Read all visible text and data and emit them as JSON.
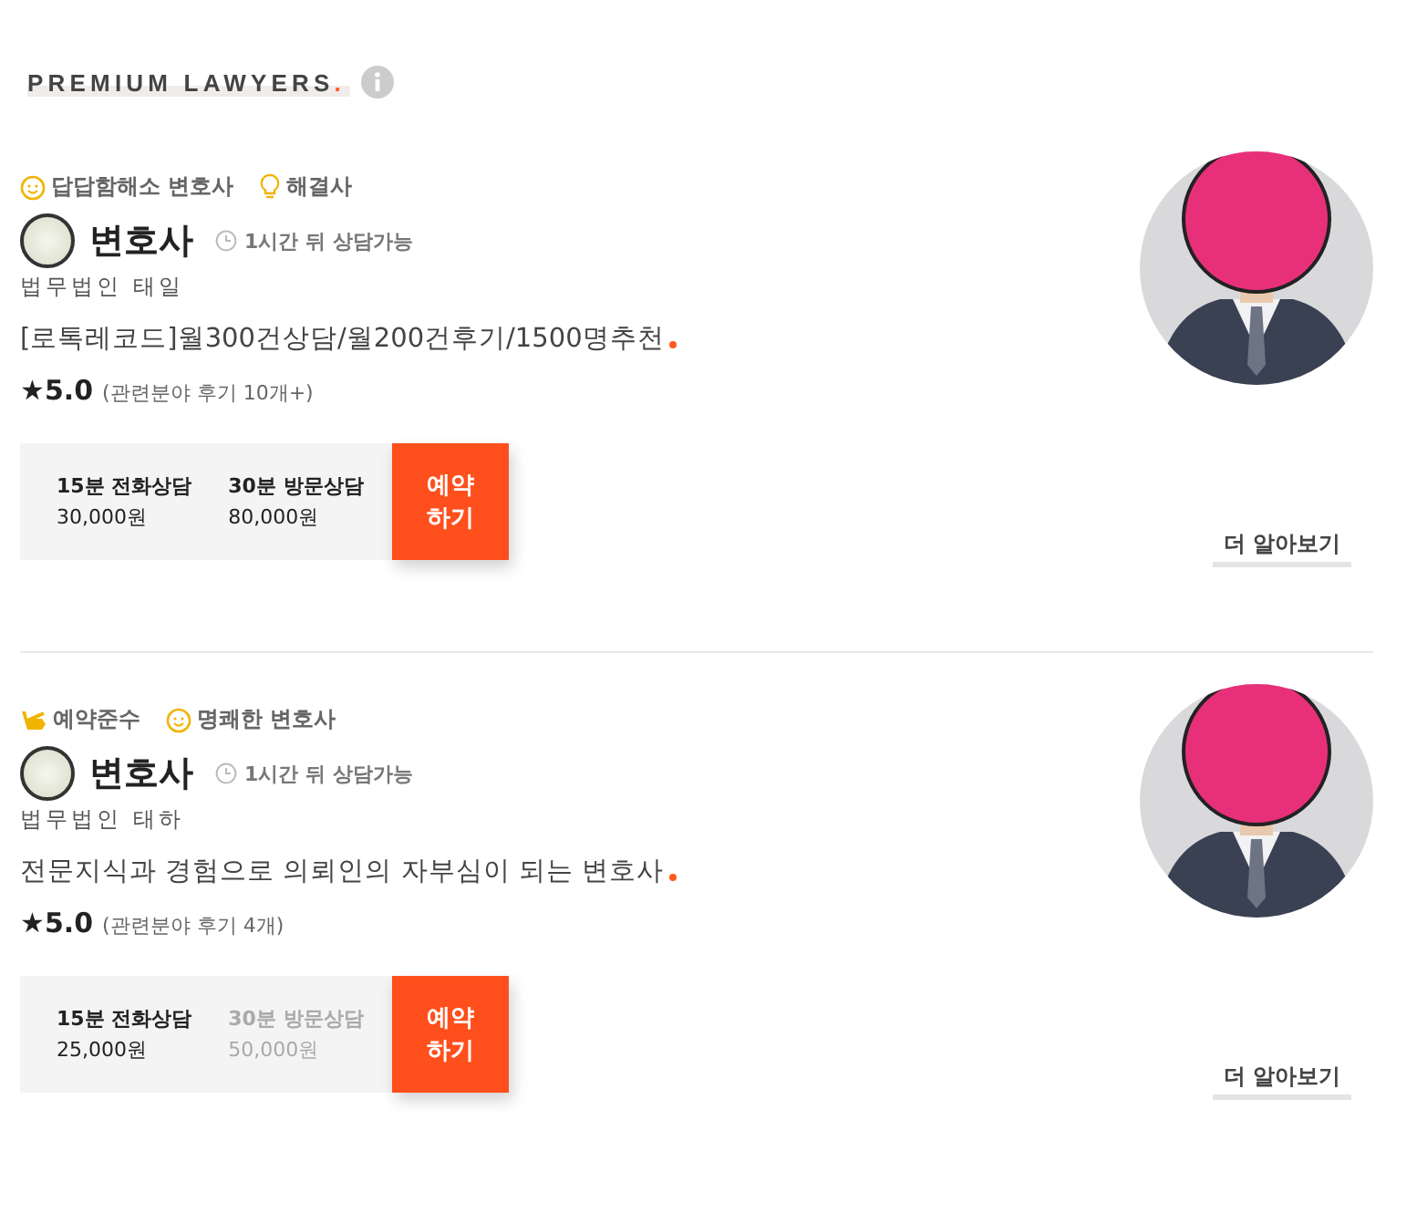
{
  "header": {
    "title": "PREMIUM LAWYERS",
    "dot": "."
  },
  "lawyers": [
    {
      "tags": [
        {
          "kind": "smile",
          "label": "답답함해소 변호사"
        },
        {
          "kind": "bulb",
          "label": "해결사"
        }
      ],
      "name": "변호사",
      "availability": "1시간 뒤 상담가능",
      "firm": "법무법인 태일",
      "intro": "[로톡레코드]월300건상담/월200건후기/1500명추천",
      "rating": "★5.0",
      "reviews": "(관련분야 후기 10개+)",
      "prices": [
        {
          "label": "15분 전화상담",
          "price": "30,000원",
          "available": true
        },
        {
          "label": "30분 방문상담",
          "price": "80,000원",
          "available": true
        }
      ],
      "book": "예약\n하기",
      "more": "더 알아보기"
    },
    {
      "tags": [
        {
          "kind": "hand",
          "label": "예약준수"
        },
        {
          "kind": "smile",
          "label": "명쾌한 변호사"
        }
      ],
      "name": "변호사",
      "availability": "1시간 뒤 상담가능",
      "firm": "법무법인 태하",
      "intro": "전문지식과 경험으로 의뢰인의 자부심이 되는 변호사",
      "rating": "★5.0",
      "reviews": "(관련분야 후기 4개)",
      "prices": [
        {
          "label": "15분 전화상담",
          "price": "25,000원",
          "available": true
        },
        {
          "label": "30분 방문상담",
          "price": "50,000원",
          "available": false
        }
      ],
      "book": "예약\n하기",
      "more": "더 알아보기"
    }
  ]
}
